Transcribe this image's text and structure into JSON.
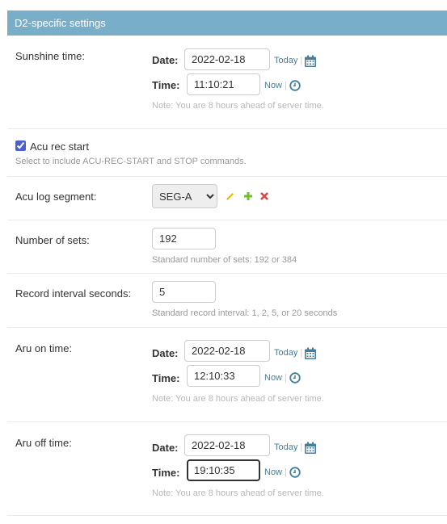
{
  "fieldset": {
    "title": "D2-specific settings"
  },
  "sunshine": {
    "label": "Sunshine time:",
    "date_label": "Date:",
    "date_value": "2022-02-18",
    "time_label": "Time:",
    "time_value": "11:10:21",
    "today": "Today",
    "now": "Now",
    "note": "Note: You are 8 hours ahead of server time."
  },
  "acu_rec": {
    "label": "Acu rec start",
    "checked": true,
    "help": "Select to include ACU-REC-START and STOP commands."
  },
  "acu_log": {
    "label": "Acu log segment:",
    "selected": "SEG-A",
    "icons": [
      "pencil-icon",
      "plus-icon",
      "delete-x-icon"
    ]
  },
  "num_sets": {
    "label": "Number of sets:",
    "value": "192",
    "help": "Standard number of sets: 192 or 384"
  },
  "record_interval": {
    "label": "Record interval seconds:",
    "value": "5",
    "help": "Standard record interval: 1, 2, 5, or 20 seconds"
  },
  "aru_on": {
    "label": "Aru on time:",
    "date_label": "Date:",
    "date_value": "2022-02-18",
    "time_label": "Time:",
    "time_value": "12:10:33",
    "today": "Today",
    "now": "Now",
    "note": "Note: You are 8 hours ahead of server time."
  },
  "aru_off": {
    "label": "Aru off time:",
    "date_label": "Date:",
    "date_value": "2022-02-18",
    "time_label": "Time:",
    "time_value": "19:10:35",
    "today": "Today",
    "now": "Now",
    "note": "Note: You are 8 hours ahead of server time."
  },
  "colors": {
    "header_bg": "#79aec8",
    "link": "#447e9b",
    "checkbox": "#4a5fd2"
  }
}
